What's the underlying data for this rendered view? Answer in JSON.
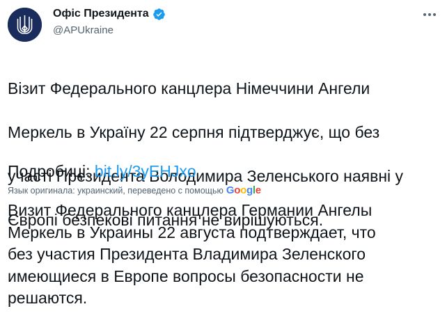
{
  "author": {
    "display_name": "Офіс Президента",
    "handle": "@APUkraine",
    "avatar_icon": "ukraine-trident-icon",
    "verified_icon": "verified-badge-icon",
    "colors": {
      "avatar_bg": "#1a2c5b",
      "verified": "#1d9bf0"
    }
  },
  "tweet": {
    "text_lines": [
      "Візит Федерального канцлера Німеччини Ангели",
      "Меркель в Україну 22 серпня підтверджує, що без",
      "участі Президента Володимира Зеленського наявні у",
      "Європі безпекові питання не вирішуються."
    ],
    "details_label": "Подробиці: ",
    "details_link": "bit.ly/3yEHJxo",
    "link_color": "#1d9bf0"
  },
  "translation": {
    "note": "Язык оригинала: украинский, переведено с помощью",
    "provider_letters": [
      {
        "ch": "G",
        "color": "#4285f4"
      },
      {
        "ch": "o",
        "color": "#ea4335"
      },
      {
        "ch": "o",
        "color": "#fbbc05"
      },
      {
        "ch": "g",
        "color": "#4285f4"
      },
      {
        "ch": "l",
        "color": "#34a853"
      },
      {
        "ch": "e",
        "color": "#ea4335"
      }
    ],
    "text_lines": [
      "Визит Федерального канцлера Германии Ангелы",
      "Меркель в Украины 22 августа подтверждает, что",
      "без участия Президента Владимира Зеленского",
      "имеющиеся в Европе вопросы безопасности не",
      "решаются."
    ]
  },
  "actions": {
    "more_icon": "more-options-icon"
  }
}
